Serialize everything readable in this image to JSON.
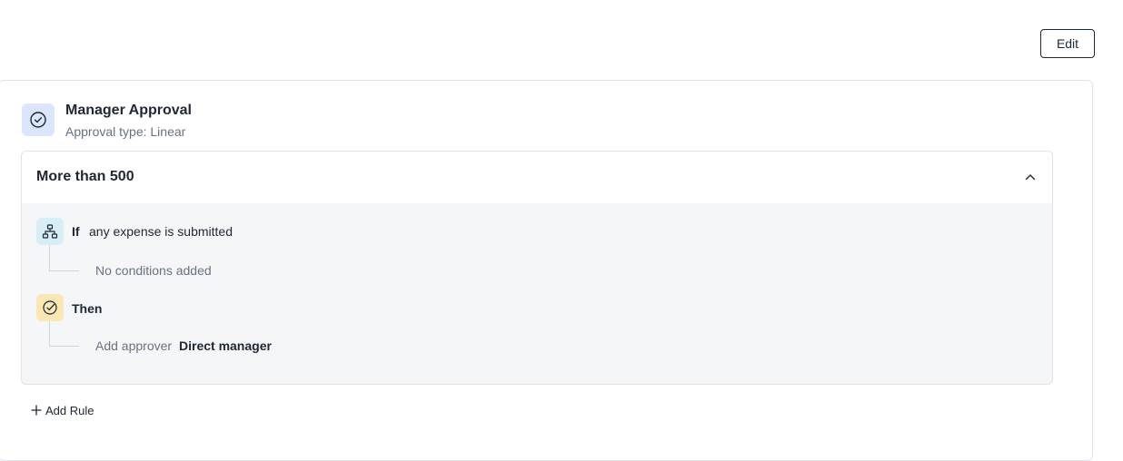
{
  "toolbar": {
    "edit_label": "Edit"
  },
  "step": {
    "title": "Manager Approval",
    "subtitle": "Approval type: Linear",
    "icon": "check-circle-icon"
  },
  "rule": {
    "title": "More than 500",
    "if_keyword": "If",
    "if_text": "any expense is submitted",
    "conditions_text": "No conditions added",
    "then_keyword": "Then",
    "action_label": "Add approver",
    "action_value": "Direct manager"
  },
  "footer": {
    "add_rule_label": "Add Rule"
  },
  "colors": {
    "step_icon_bg": "#dbe5fb",
    "if_icon_bg": "#d8eef6",
    "then_icon_bg": "#fbe7b5",
    "panel_bg": "#f4f6f8"
  }
}
